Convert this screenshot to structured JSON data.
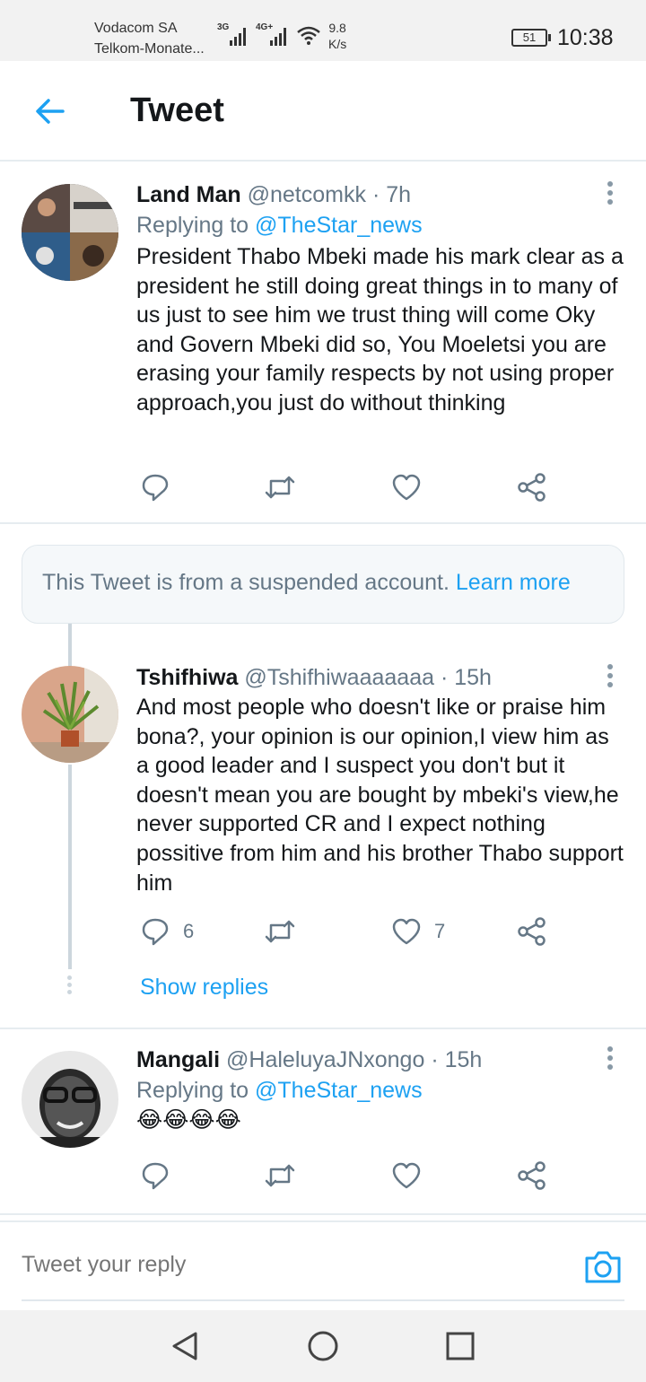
{
  "status_bar": {
    "carrier1": "Vodacom SA",
    "carrier2": "Telkom-Monate...",
    "signal1": "3G",
    "signal2": "4G+",
    "speed_value": "9.8",
    "speed_unit": "K/s",
    "battery": "51",
    "time": "10:38"
  },
  "header": {
    "back_icon": "arrow-left-icon",
    "title": "Tweet"
  },
  "colors": {
    "accent": "#1da1f2",
    "secondary_text": "#657786",
    "primary_text": "#14171a",
    "divider": "#e6ecf0"
  },
  "tweets": [
    {
      "name": "Land Man",
      "handle": "@netcomkk",
      "dot": "·",
      "time": "7h",
      "replying_prefix": "Replying to",
      "replying_to": "@TheStar_news",
      "text": "President Thabo Mbeki made his mark clear as a president he still doing great things in to many of us just to see him we trust thing will come Oky and Govern Mbeki did so, You Moeletsi you are erasing your family respects by not using proper approach,you just do without thinking",
      "replies": "",
      "likes": ""
    },
    {
      "name": "Tshifhiwa",
      "handle": "@Tshifhiwaaaaaaa",
      "dot": "·",
      "time": "15h",
      "text": "And most people who doesn't like or praise him bona?, your opinion is our opinion,I view him as a good leader and I suspect you don't but it doesn't mean you are bought by mbeki's view,he never supported CR and I expect nothing possitive from him and his brother Thabo support him",
      "replies": "6",
      "likes": "7"
    },
    {
      "name": "Mangali",
      "handle": "@HaleluyaJNxongo",
      "dot": "·",
      "time": "15h",
      "replying_prefix": "Replying to",
      "replying_to": "@TheStar_news",
      "text": "😂😂😂😂",
      "replies": "",
      "likes": ""
    }
  ],
  "suspended_notice": {
    "text": "This Tweet is from a suspended account.",
    "link": "Learn more"
  },
  "show_replies": "Show replies",
  "reply_bar": {
    "placeholder": "Tweet your reply",
    "camera_icon": "camera-icon"
  },
  "nav": {
    "back": "nav-back-icon",
    "home": "nav-home-icon",
    "recents": "nav-recents-icon"
  }
}
